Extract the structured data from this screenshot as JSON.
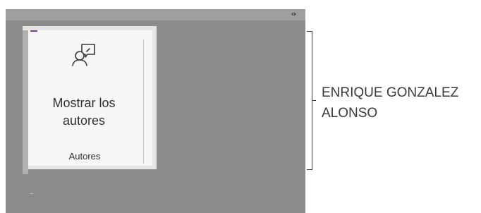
{
  "panel": {
    "collapse_icon": "code-brackets-icon"
  },
  "ribbon": {
    "button": {
      "label": "Mostrar los\nautores",
      "icon": "person-comment-icon"
    },
    "group_label": "Autores"
  },
  "annotation": {
    "name": "ENRIQUE GONZALEZ\nALONSO"
  },
  "colors": {
    "panel_background": "#8c8b8a",
    "ribbon_background": "#f7f6f4",
    "accent": "#7b3fa8",
    "text": "#323130"
  }
}
